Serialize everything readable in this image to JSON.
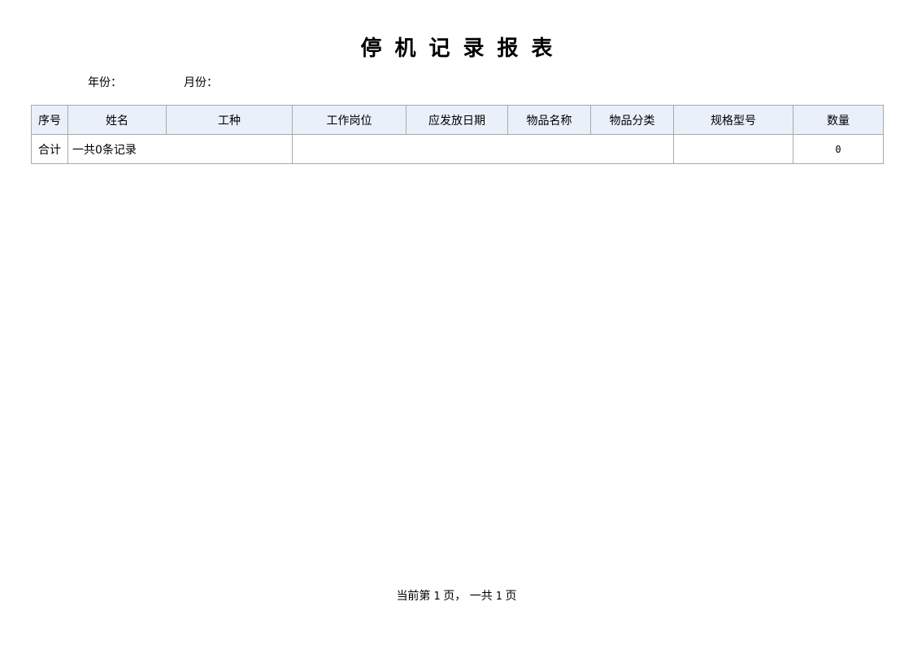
{
  "report": {
    "title": "停机记录报表"
  },
  "filters": {
    "year_label": "年份：",
    "year_value": "",
    "month_label": "月份：",
    "month_value": ""
  },
  "table": {
    "columns": [
      "序号",
      "姓名",
      "工种",
      "工作岗位",
      "应发放日期",
      "物品名称",
      "物品分类",
      "规格型号",
      "数量"
    ],
    "rows": [],
    "summary": {
      "label": "合计",
      "record_text": "一共0条记录",
      "merged_blank": "",
      "spec_blank": "",
      "quantity_total": "0"
    }
  },
  "pager": {
    "prefix": "当前第",
    "current_page": "1",
    "middle": "页，  一共",
    "total_pages": "1",
    "suffix": "页"
  },
  "colors": {
    "header_bg": "#e9f0fa",
    "border": "#a9a9a9"
  }
}
